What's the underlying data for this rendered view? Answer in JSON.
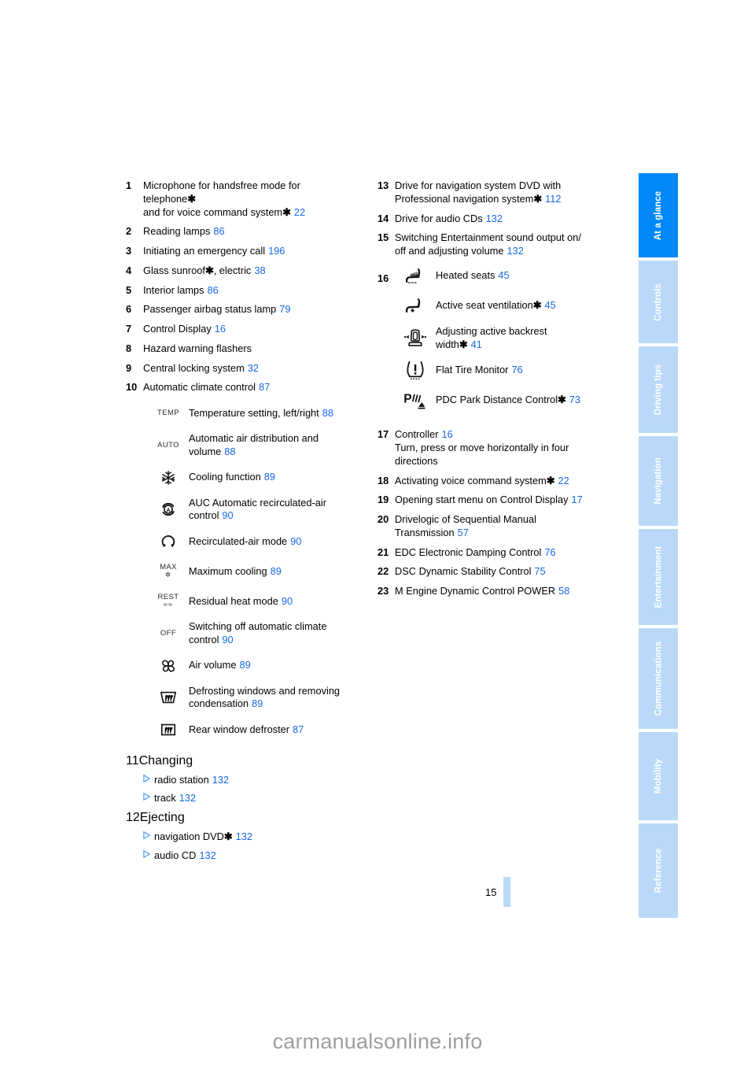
{
  "page": {
    "number": "15",
    "watermark": "carmanualsonline.info",
    "accent_blue": "#1768E8",
    "tab_active_blue": "#0088F7",
    "tab_inactive_blue": "#BAD9F8",
    "triangle_blue": "#4FA3F7"
  },
  "sidebar": {
    "tabs": [
      {
        "label": "At a glance",
        "active": true
      },
      {
        "label": "Controls",
        "active": false
      },
      {
        "label": "Driving tips",
        "active": false
      },
      {
        "label": "Navigation",
        "active": false
      },
      {
        "label": "Entertainment",
        "active": false
      },
      {
        "label": "Communications",
        "active": false
      },
      {
        "label": "Mobility",
        "active": false
      },
      {
        "label": "Reference",
        "active": false
      }
    ]
  },
  "left_column": {
    "items": [
      {
        "num": "1",
        "lines": [
          "Microphone for handsfree mode for",
          "telephone*",
          "and for voice command system*"
        ],
        "page": "22",
        "star_lines": [
          1,
          2
        ]
      },
      {
        "num": "2",
        "lines": [
          "Reading lamps"
        ],
        "page": "86"
      },
      {
        "num": "3",
        "lines": [
          "Initiating an emergency call"
        ],
        "page": "196"
      },
      {
        "num": "4",
        "lines": [
          "Glass sunroof*, electric"
        ],
        "page": "38"
      },
      {
        "num": "5",
        "lines": [
          "Interior lamps"
        ],
        "page": "86"
      },
      {
        "num": "6",
        "lines": [
          "Passenger airbag status lamp"
        ],
        "page": "79"
      },
      {
        "num": "7",
        "lines": [
          "Control Display"
        ],
        "page": "16"
      },
      {
        "num": "8",
        "lines": [
          "Hazard warning flashers"
        ],
        "page": ""
      },
      {
        "num": "9",
        "lines": [
          "Central locking system"
        ],
        "page": "32"
      },
      {
        "num": "10",
        "lines": [
          "Automatic climate control"
        ],
        "page": "87"
      }
    ],
    "climate_icons": [
      {
        "icon": "temp-text-icon",
        "icon_text": "TEMP",
        "label": "Temperature setting, left/right",
        "page": "88"
      },
      {
        "icon": "auto-text-icon",
        "icon_text": "AUTO",
        "label": "Automatic air distribution and volume",
        "page": "88"
      },
      {
        "icon": "snowflake-icon",
        "icon_text": "",
        "label": "Cooling function",
        "page": "89"
      },
      {
        "icon": "auc-recirculation-icon",
        "icon_text": "",
        "label": "AUC Automatic recirculated-air control",
        "page": "90"
      },
      {
        "icon": "recirculated-air-icon",
        "icon_text": "",
        "label": "Recirculated-air mode",
        "page": "90"
      },
      {
        "icon": "max-cooling-icon",
        "icon_text": "MAX",
        "label": "Maximum cooling",
        "page": "89"
      },
      {
        "icon": "residual-heat-icon",
        "icon_text": "REST",
        "label": "Residual heat mode",
        "page": "90"
      },
      {
        "icon": "off-text-icon",
        "icon_text": "OFF",
        "label": "Switching off automatic climate control",
        "page": "90"
      },
      {
        "icon": "fan-icon",
        "icon_text": "",
        "label": "Air volume",
        "page": "89"
      },
      {
        "icon": "windshield-defrost-icon",
        "icon_text": "",
        "label": "Defrosting windows and removing condensation",
        "page": "89"
      },
      {
        "icon": "rear-defroster-icon",
        "icon_text": "",
        "label": "Rear window defroster",
        "page": "87"
      }
    ],
    "item11": {
      "num": "11",
      "title": "Changing",
      "subitems": [
        {
          "label": "radio station",
          "page": "132"
        },
        {
          "label": "track",
          "page": "132"
        }
      ]
    },
    "item12": {
      "num": "12",
      "title": "Ejecting",
      "subitems": [
        {
          "label": "navigation DVD*",
          "page": "132"
        },
        {
          "label": "audio CD",
          "page": "132"
        }
      ]
    }
  },
  "right_column": {
    "items_top": [
      {
        "num": "13",
        "lines": [
          "Drive for navigation system DVD with",
          "Professional navigation system*"
        ],
        "page": "112"
      },
      {
        "num": "14",
        "lines": [
          "Drive for audio CDs"
        ],
        "page": "132"
      },
      {
        "num": "15",
        "lines": [
          "Switching Entertainment sound output on/",
          "off and adjusting volume"
        ],
        "page": "132"
      }
    ],
    "item16": {
      "num": "16",
      "icons": [
        {
          "icon": "heated-seat-icon",
          "label": "Heated seats",
          "page": "45"
        },
        {
          "icon": "ventilated-seat-icon",
          "label": "Active seat ventilation*",
          "page": "45"
        },
        {
          "icon": "backrest-width-icon",
          "label": "Adjusting active backrest width*",
          "page": "41"
        },
        {
          "icon": "flat-tire-monitor-icon",
          "label": "Flat Tire Monitor",
          "page": "76"
        },
        {
          "icon": "pdc-icon",
          "label": "PDC Park Distance Control*",
          "page": "73"
        }
      ]
    },
    "items_bottom": [
      {
        "num": "17",
        "lines": [
          "Controller",
          "Turn, press or move horizontally in four",
          "directions"
        ],
        "page": "16",
        "page_on_line": 0
      },
      {
        "num": "18",
        "lines": [
          "Activating voice command system*"
        ],
        "page": "22"
      },
      {
        "num": "19",
        "lines": [
          "Opening start menu on Control Display"
        ],
        "page": "17"
      },
      {
        "num": "20",
        "lines": [
          "Drivelogic of Sequential Manual",
          "Transmission"
        ],
        "page": "57"
      },
      {
        "num": "21",
        "lines": [
          "EDC Electronic Damping Control"
        ],
        "page": "76"
      },
      {
        "num": "22",
        "lines": [
          "DSC Dynamic Stability Control"
        ],
        "page": "75"
      },
      {
        "num": "23",
        "lines": [
          "M Engine Dynamic Control POWER"
        ],
        "page": "58"
      }
    ]
  }
}
